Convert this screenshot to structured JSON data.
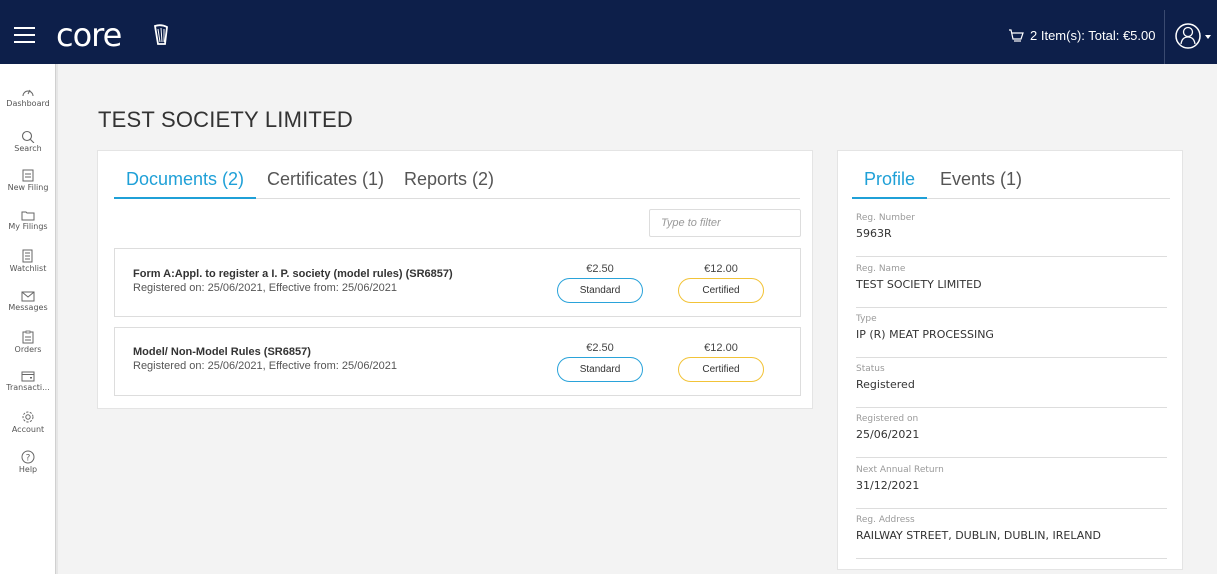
{
  "header": {
    "logo": "core",
    "cart_text": "2 Item(s): Total: €5.00",
    "bg_color": "#0d1f4a"
  },
  "sidebar": {
    "items": [
      {
        "label": "Dashboard",
        "icon": "dashboard-icon"
      },
      {
        "label": "Search",
        "icon": "search-icon"
      },
      {
        "label": "New Filing",
        "icon": "new-filing-icon"
      },
      {
        "label": "My Filings",
        "icon": "folder-icon"
      },
      {
        "label": "Watchlist",
        "icon": "watchlist-icon"
      },
      {
        "label": "Messages",
        "icon": "envelope-icon"
      },
      {
        "label": "Orders",
        "icon": "clipboard-icon"
      },
      {
        "label": "Transacti...",
        "icon": "wallet-icon"
      },
      {
        "label": "Account",
        "icon": "gear-icon"
      },
      {
        "label": "Help",
        "icon": "help-icon"
      }
    ]
  },
  "page": {
    "title": "TEST SOCIETY LIMITED"
  },
  "main": {
    "tabs": [
      {
        "label": "Documents (2)",
        "active": true
      },
      {
        "label": "Certificates (1)",
        "active": false
      },
      {
        "label": "Reports (2)",
        "active": false
      }
    ],
    "filter_placeholder": "Type to filter",
    "documents": [
      {
        "title": "Form A:Appl. to register a I. P. society (model rules) (SR6857)",
        "subtitle": "Registered on: 25/06/2021, Effective from: 25/06/2021",
        "standard_price": "€2.50",
        "standard_label": "Standard",
        "certified_price": "€12.00",
        "certified_label": "Certified"
      },
      {
        "title": "Model/ Non-Model Rules (SR6857)",
        "subtitle": "Registered on: 25/06/2021, Effective from: 25/06/2021",
        "standard_price": "€2.50",
        "standard_label": "Standard",
        "certified_price": "€12.00",
        "certified_label": "Certified"
      }
    ]
  },
  "profile": {
    "tabs": [
      {
        "label": "Profile",
        "active": true
      },
      {
        "label": "Events (1)",
        "active": false
      }
    ],
    "fields": [
      {
        "label": "Reg. Number",
        "value": "5963R"
      },
      {
        "label": "Reg. Name",
        "value": "TEST SOCIETY LIMITED"
      },
      {
        "label": "Type",
        "value": "IP (R) MEAT PROCESSING"
      },
      {
        "label": "Status",
        "value": "Registered"
      },
      {
        "label": "Registered on",
        "value": "25/06/2021"
      },
      {
        "label": "Next Annual Return",
        "value": "31/12/2021"
      },
      {
        "label": "Reg. Address",
        "value": "RAILWAY STREET, DUBLIN, DUBLIN, IRELAND"
      }
    ]
  },
  "colors": {
    "accent": "#1fa0d7",
    "standard_border": "#2aa3da",
    "certified_border": "#f2c338"
  }
}
